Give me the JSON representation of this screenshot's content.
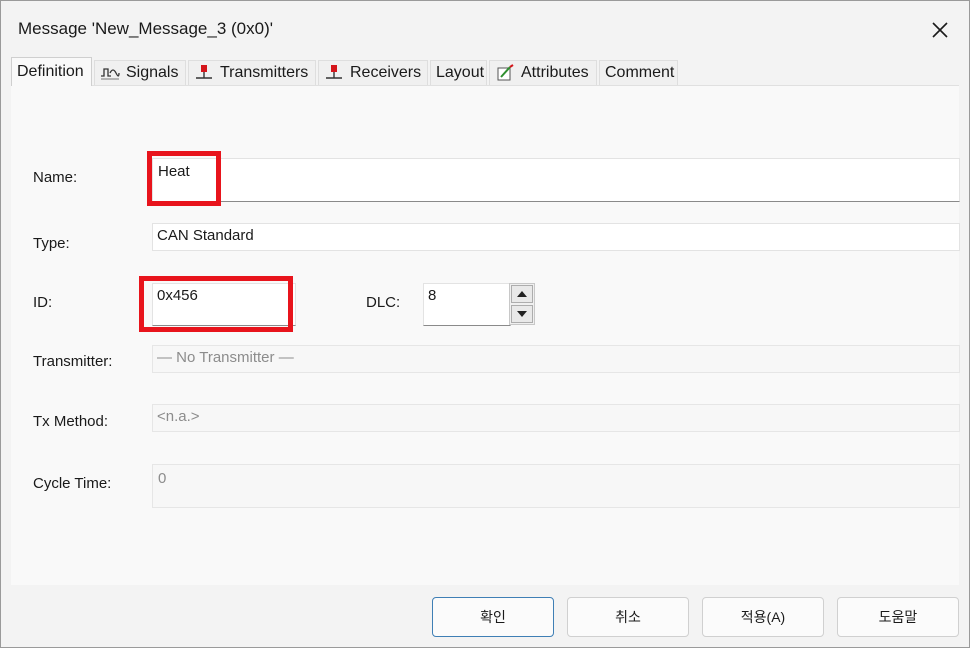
{
  "window": {
    "title": "Message 'New_Message_3 (0x0)'"
  },
  "tabs": [
    {
      "label": "Definition",
      "icon": "none"
    },
    {
      "label": "Signals",
      "icon": "signal-wave-icon"
    },
    {
      "label": "Transmitters",
      "icon": "node-icon"
    },
    {
      "label": "Receivers",
      "icon": "node-icon"
    },
    {
      "label": "Layout",
      "icon": "none"
    },
    {
      "label": "Attributes",
      "icon": "attributes-icon"
    },
    {
      "label": "Comment",
      "icon": "none"
    }
  ],
  "form": {
    "name_label": "Name:",
    "name_value": "Heat",
    "type_label": "Type:",
    "type_value": "CAN Standard",
    "id_label": "ID:",
    "id_value": "0x456",
    "dlc_label": "DLC:",
    "dlc_value": "8",
    "transmitter_label": "Transmitter:",
    "transmitter_value": "— No Transmitter —",
    "txmethod_label": "Tx Method:",
    "txmethod_value": "<n.a.>",
    "cycletime_label": "Cycle Time:",
    "cycletime_value": "0"
  },
  "buttons": {
    "ok": "확인",
    "cancel": "취소",
    "apply": "적용(A)",
    "help": "도움말"
  },
  "colors": {
    "highlight": "#e8141c",
    "primary_border": "#3f7fb5"
  }
}
